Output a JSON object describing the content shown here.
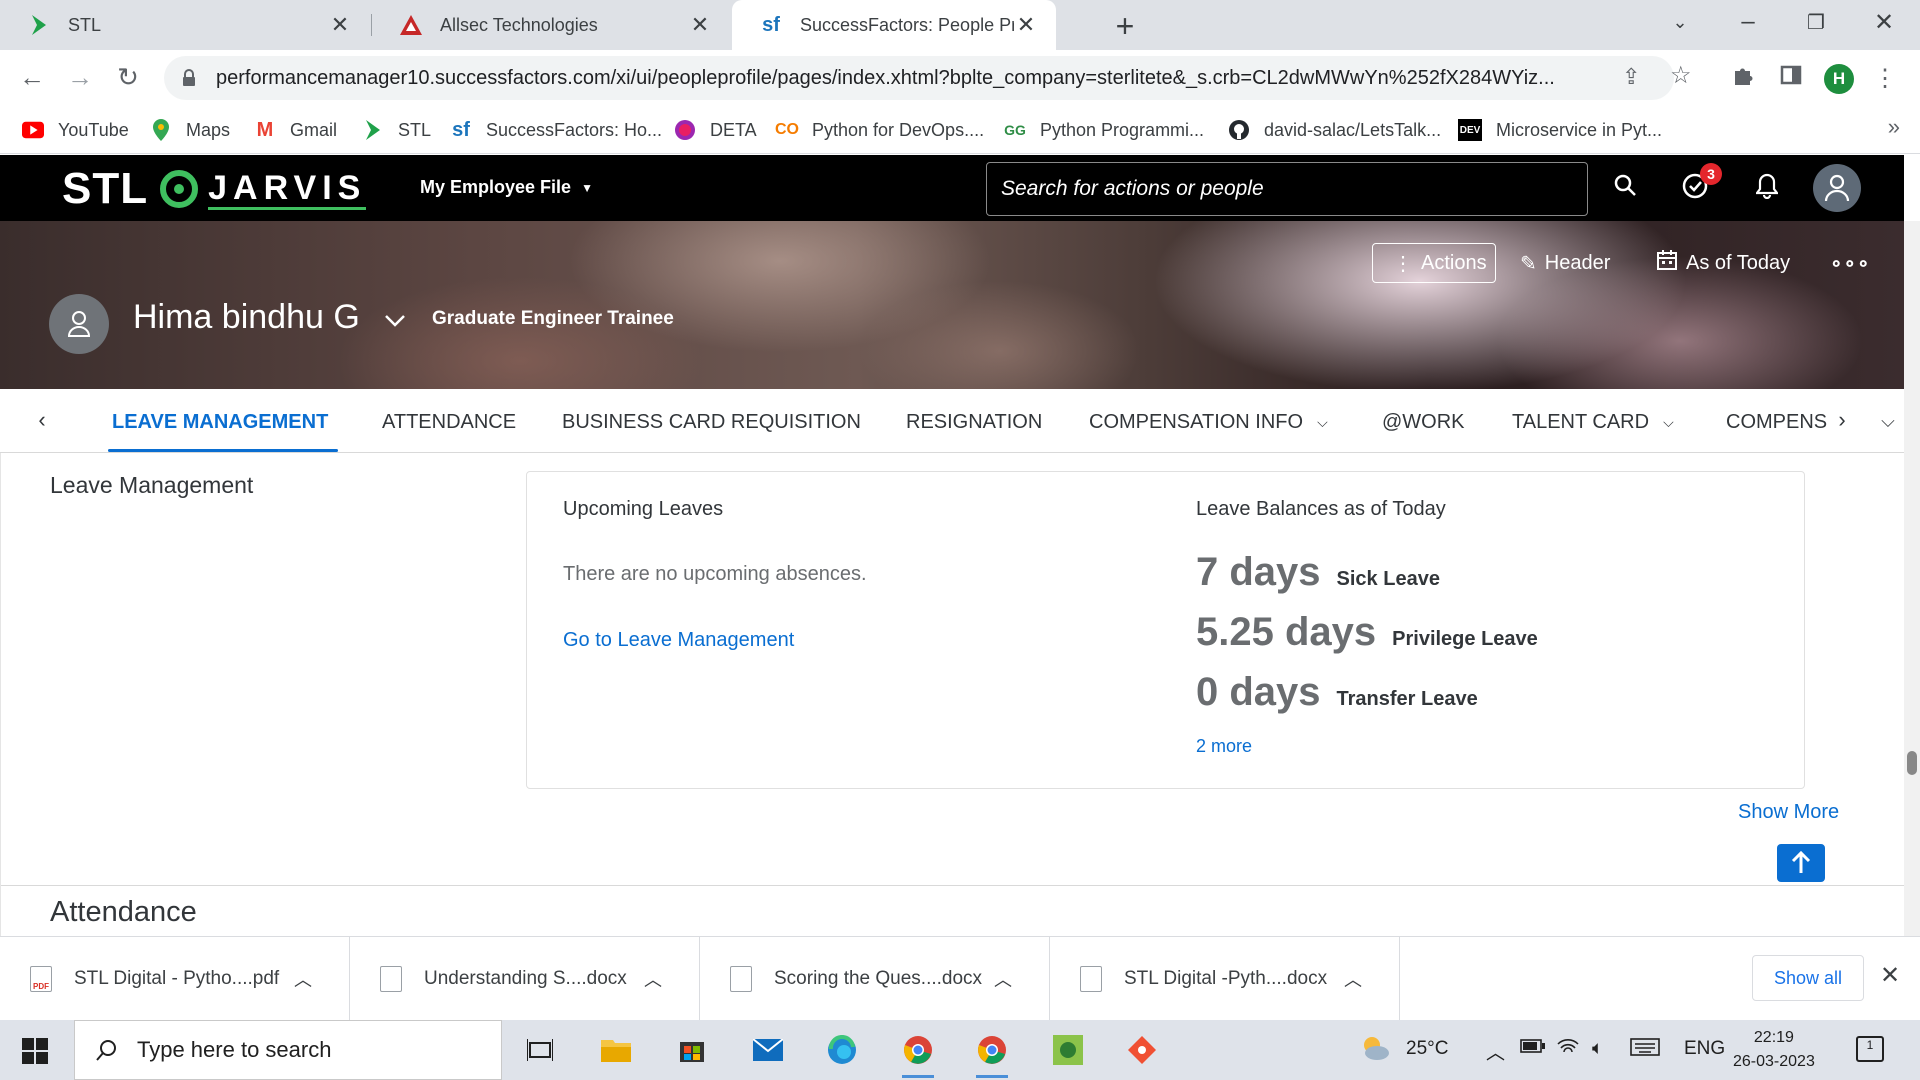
{
  "browser": {
    "tabs": [
      {
        "title": "STL",
        "active": false
      },
      {
        "title": "Allsec Technologies",
        "active": false
      },
      {
        "title": "SuccessFactors: People Profile",
        "active": true
      }
    ],
    "url": "performancemanager10.successfactors.com/xi/ui/peopleprofile/pages/index.xhtml?bplte_company=sterlitete&_s.crb=CL2dwMWwYn%252fX284WYiz...",
    "profile_initial": "H",
    "bookmarks": [
      {
        "label": "YouTube",
        "icon": "youtube-icon"
      },
      {
        "label": "Maps",
        "icon": "maps-pin-icon"
      },
      {
        "label": "Gmail",
        "icon": "gmail-icon"
      },
      {
        "label": "STL",
        "icon": "stl-icon"
      },
      {
        "label": "SuccessFactors: Ho...",
        "icon": "successfactors-icon"
      },
      {
        "label": "DETA",
        "icon": "deta-icon"
      },
      {
        "label": "Python for DevOps....",
        "icon": "coursera-icon"
      },
      {
        "label": "Python Programmi...",
        "icon": "geeksforgeeks-icon"
      },
      {
        "label": "david-salac/LetsTalk...",
        "icon": "github-icon"
      },
      {
        "label": "Microservice in Pyt...",
        "icon": "dev-icon"
      }
    ]
  },
  "sf": {
    "logo_stl": "STL",
    "logo_jarvis": "JARVIS",
    "nav_menu": "My Employee File",
    "search_placeholder": "Search for actions or people",
    "todo_badge": "3"
  },
  "profile": {
    "name": "Hima bindhu G",
    "job_title": "Graduate Engineer Trainee",
    "actions_label": "Actions",
    "header_label": "Header",
    "as_of_label": "As of Today"
  },
  "section_tabs": [
    {
      "label": "LEAVE MANAGEMENT",
      "active": true,
      "dropdown": false
    },
    {
      "label": "ATTENDANCE",
      "active": false,
      "dropdown": false
    },
    {
      "label": "BUSINESS CARD REQUISITION",
      "active": false,
      "dropdown": false
    },
    {
      "label": "RESIGNATION",
      "active": false,
      "dropdown": false
    },
    {
      "label": "COMPENSATION INFO",
      "active": false,
      "dropdown": true
    },
    {
      "label": "@WORK",
      "active": false,
      "dropdown": false
    },
    {
      "label": "TALENT CARD",
      "active": false,
      "dropdown": true
    },
    {
      "label": "COMPENS",
      "active": false,
      "dropdown": false
    }
  ],
  "leave": {
    "heading": "Leave Management",
    "upcoming_title": "Upcoming Leaves",
    "no_absences": "There are no upcoming absences.",
    "go_link": "Go to Leave Management",
    "balances_title": "Leave Balances as of Today",
    "balances": [
      {
        "value": "7 days",
        "type": "Sick Leave"
      },
      {
        "value": "5.25 days",
        "type": "Privilege Leave"
      },
      {
        "value": "0 days",
        "type": "Transfer Leave"
      }
    ],
    "more_link": "2 more",
    "show_more": "Show More"
  },
  "attendance": {
    "heading": "Attendance"
  },
  "downloads": {
    "items": [
      "STL Digital - Pytho....pdf",
      "Understanding S....docx",
      "Scoring the Ques....docx",
      "STL Digital -Pyth....docx"
    ],
    "show_all": "Show all"
  },
  "taskbar": {
    "search_placeholder": "Type here to search",
    "temperature": "25°C",
    "language": "ENG",
    "time": "22:19",
    "date": "26-03-2023",
    "notifications": "1"
  },
  "colors": {
    "accent": "#0a6ed1",
    "header_bg": "#000000",
    "badge": "#e4262c",
    "logo_green": "#3fbf5f"
  }
}
